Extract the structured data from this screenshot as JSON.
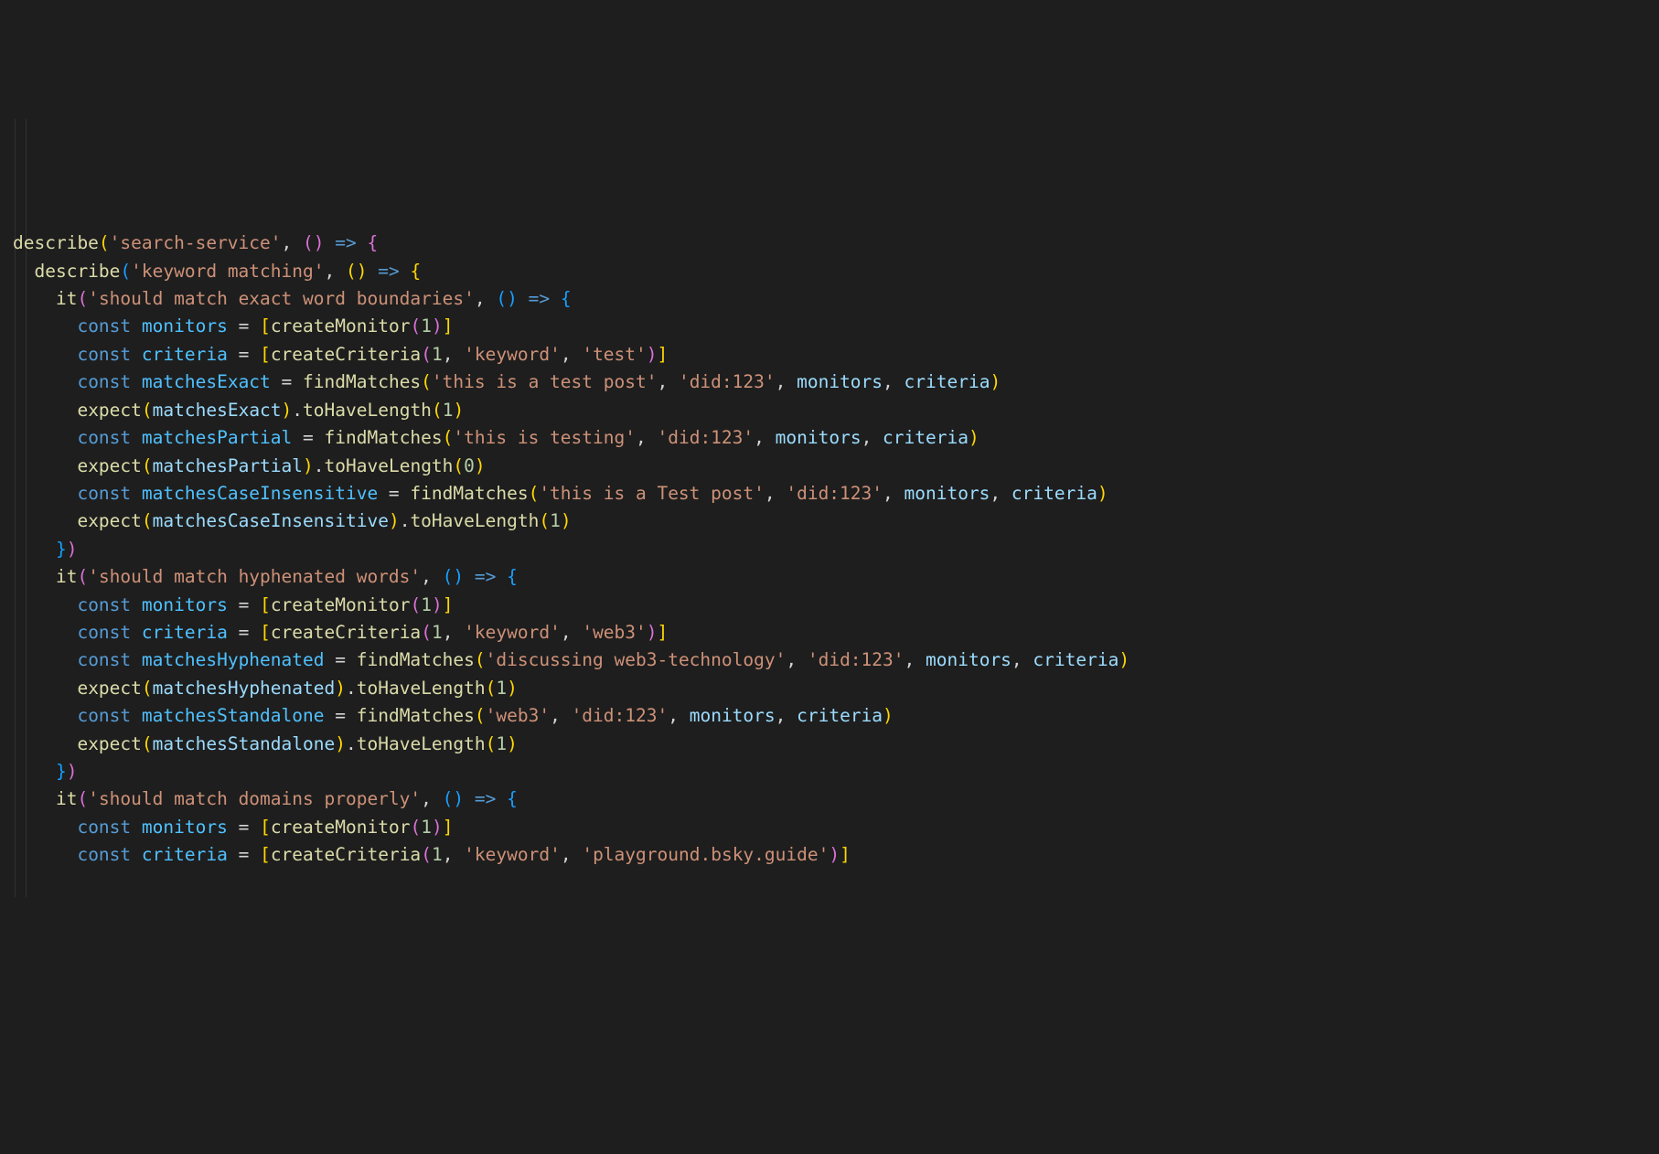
{
  "tokens": [
    [
      {
        "c": "fn",
        "t": "describe"
      },
      {
        "c": "paren1",
        "t": "("
      },
      {
        "c": "str",
        "t": "'search-service'"
      },
      {
        "c": "op",
        "t": ", "
      },
      {
        "c": "paren2",
        "t": "("
      },
      {
        "c": "paren2",
        "t": ")"
      },
      {
        "c": "op",
        "t": " "
      },
      {
        "c": "kw",
        "t": "=>"
      },
      {
        "c": "op",
        "t": " "
      },
      {
        "c": "paren2",
        "t": "{"
      }
    ],
    [
      {
        "c": "op",
        "t": "  "
      },
      {
        "c": "fn",
        "t": "describe"
      },
      {
        "c": "paren3",
        "t": "("
      },
      {
        "c": "str",
        "t": "'keyword matching'"
      },
      {
        "c": "op",
        "t": ", "
      },
      {
        "c": "paren1",
        "t": "("
      },
      {
        "c": "paren1",
        "t": ")"
      },
      {
        "c": "op",
        "t": " "
      },
      {
        "c": "kw",
        "t": "=>"
      },
      {
        "c": "op",
        "t": " "
      },
      {
        "c": "paren1",
        "t": "{"
      }
    ],
    [
      {
        "c": "op",
        "t": "    "
      },
      {
        "c": "fn",
        "t": "it"
      },
      {
        "c": "paren2",
        "t": "("
      },
      {
        "c": "str",
        "t": "'should match exact word boundaries'"
      },
      {
        "c": "op",
        "t": ", "
      },
      {
        "c": "paren3",
        "t": "("
      },
      {
        "c": "paren3",
        "t": ")"
      },
      {
        "c": "op",
        "t": " "
      },
      {
        "c": "kw",
        "t": "=>"
      },
      {
        "c": "op",
        "t": " "
      },
      {
        "c": "paren3",
        "t": "{"
      }
    ],
    [
      {
        "c": "op",
        "t": "      "
      },
      {
        "c": "kw",
        "t": "const"
      },
      {
        "c": "op",
        "t": " "
      },
      {
        "c": "const",
        "t": "monitors"
      },
      {
        "c": "op",
        "t": " = "
      },
      {
        "c": "paren1",
        "t": "["
      },
      {
        "c": "fn",
        "t": "createMonitor"
      },
      {
        "c": "paren2",
        "t": "("
      },
      {
        "c": "num",
        "t": "1"
      },
      {
        "c": "paren2",
        "t": ")"
      },
      {
        "c": "paren1",
        "t": "]"
      }
    ],
    [
      {
        "c": "op",
        "t": "      "
      },
      {
        "c": "kw",
        "t": "const"
      },
      {
        "c": "op",
        "t": " "
      },
      {
        "c": "const",
        "t": "criteria"
      },
      {
        "c": "op",
        "t": " = "
      },
      {
        "c": "paren1",
        "t": "["
      },
      {
        "c": "fn",
        "t": "createCriteria"
      },
      {
        "c": "paren2",
        "t": "("
      },
      {
        "c": "num",
        "t": "1"
      },
      {
        "c": "op",
        "t": ", "
      },
      {
        "c": "str",
        "t": "'keyword'"
      },
      {
        "c": "op",
        "t": ", "
      },
      {
        "c": "str",
        "t": "'test'"
      },
      {
        "c": "paren2",
        "t": ")"
      },
      {
        "c": "paren1",
        "t": "]"
      }
    ],
    [
      {
        "c": "op",
        "t": ""
      }
    ],
    [
      {
        "c": "op",
        "t": "      "
      },
      {
        "c": "kw",
        "t": "const"
      },
      {
        "c": "op",
        "t": " "
      },
      {
        "c": "const",
        "t": "matchesExact"
      },
      {
        "c": "op",
        "t": " = "
      },
      {
        "c": "fn",
        "t": "findMatches"
      },
      {
        "c": "paren1",
        "t": "("
      },
      {
        "c": "str",
        "t": "'this is a test post'"
      },
      {
        "c": "op",
        "t": ", "
      },
      {
        "c": "str",
        "t": "'did:123'"
      },
      {
        "c": "op",
        "t": ", "
      },
      {
        "c": "var",
        "t": "monitors"
      },
      {
        "c": "op",
        "t": ", "
      },
      {
        "c": "var",
        "t": "criteria"
      },
      {
        "c": "paren1",
        "t": ")"
      }
    ],
    [
      {
        "c": "op",
        "t": "      "
      },
      {
        "c": "fn",
        "t": "expect"
      },
      {
        "c": "paren1",
        "t": "("
      },
      {
        "c": "var",
        "t": "matchesExact"
      },
      {
        "c": "paren1",
        "t": ")"
      },
      {
        "c": "op",
        "t": "."
      },
      {
        "c": "fn",
        "t": "toHaveLength"
      },
      {
        "c": "paren1",
        "t": "("
      },
      {
        "c": "num",
        "t": "1"
      },
      {
        "c": "paren1",
        "t": ")"
      }
    ],
    [
      {
        "c": "op",
        "t": ""
      }
    ],
    [
      {
        "c": "op",
        "t": "      "
      },
      {
        "c": "kw",
        "t": "const"
      },
      {
        "c": "op",
        "t": " "
      },
      {
        "c": "const",
        "t": "matchesPartial"
      },
      {
        "c": "op",
        "t": " = "
      },
      {
        "c": "fn",
        "t": "findMatches"
      },
      {
        "c": "paren1",
        "t": "("
      },
      {
        "c": "str",
        "t": "'this is testing'"
      },
      {
        "c": "op",
        "t": ", "
      },
      {
        "c": "str",
        "t": "'did:123'"
      },
      {
        "c": "op",
        "t": ", "
      },
      {
        "c": "var",
        "t": "monitors"
      },
      {
        "c": "op",
        "t": ", "
      },
      {
        "c": "var",
        "t": "criteria"
      },
      {
        "c": "paren1",
        "t": ")"
      }
    ],
    [
      {
        "c": "op",
        "t": "      "
      },
      {
        "c": "fn",
        "t": "expect"
      },
      {
        "c": "paren1",
        "t": "("
      },
      {
        "c": "var",
        "t": "matchesPartial"
      },
      {
        "c": "paren1",
        "t": ")"
      },
      {
        "c": "op",
        "t": "."
      },
      {
        "c": "fn",
        "t": "toHaveLength"
      },
      {
        "c": "paren1",
        "t": "("
      },
      {
        "c": "num",
        "t": "0"
      },
      {
        "c": "paren1",
        "t": ")"
      }
    ],
    [
      {
        "c": "op",
        "t": ""
      }
    ],
    [
      {
        "c": "op",
        "t": "      "
      },
      {
        "c": "kw",
        "t": "const"
      },
      {
        "c": "op",
        "t": " "
      },
      {
        "c": "const",
        "t": "matchesCaseInsensitive"
      },
      {
        "c": "op",
        "t": " = "
      },
      {
        "c": "fn",
        "t": "findMatches"
      },
      {
        "c": "paren1",
        "t": "("
      },
      {
        "c": "str",
        "t": "'this is a Test post'"
      },
      {
        "c": "op",
        "t": ", "
      },
      {
        "c": "str",
        "t": "'did:123'"
      },
      {
        "c": "op",
        "t": ", "
      },
      {
        "c": "var",
        "t": "monitors"
      },
      {
        "c": "op",
        "t": ", "
      },
      {
        "c": "var",
        "t": "criteria"
      },
      {
        "c": "paren1",
        "t": ")"
      }
    ],
    [
      {
        "c": "op",
        "t": "      "
      },
      {
        "c": "fn",
        "t": "expect"
      },
      {
        "c": "paren1",
        "t": "("
      },
      {
        "c": "var",
        "t": "matchesCaseInsensitive"
      },
      {
        "c": "paren1",
        "t": ")"
      },
      {
        "c": "op",
        "t": "."
      },
      {
        "c": "fn",
        "t": "toHaveLength"
      },
      {
        "c": "paren1",
        "t": "("
      },
      {
        "c": "num",
        "t": "1"
      },
      {
        "c": "paren1",
        "t": ")"
      }
    ],
    [
      {
        "c": "op",
        "t": "    "
      },
      {
        "c": "paren3",
        "t": "}"
      },
      {
        "c": "paren2",
        "t": ")"
      }
    ],
    [
      {
        "c": "op",
        "t": ""
      }
    ],
    [
      {
        "c": "op",
        "t": "    "
      },
      {
        "c": "fn",
        "t": "it"
      },
      {
        "c": "paren2",
        "t": "("
      },
      {
        "c": "str",
        "t": "'should match hyphenated words'"
      },
      {
        "c": "op",
        "t": ", "
      },
      {
        "c": "paren3",
        "t": "("
      },
      {
        "c": "paren3",
        "t": ")"
      },
      {
        "c": "op",
        "t": " "
      },
      {
        "c": "kw",
        "t": "=>"
      },
      {
        "c": "op",
        "t": " "
      },
      {
        "c": "paren3",
        "t": "{"
      }
    ],
    [
      {
        "c": "op",
        "t": "      "
      },
      {
        "c": "kw",
        "t": "const"
      },
      {
        "c": "op",
        "t": " "
      },
      {
        "c": "const",
        "t": "monitors"
      },
      {
        "c": "op",
        "t": " = "
      },
      {
        "c": "paren1",
        "t": "["
      },
      {
        "c": "fn",
        "t": "createMonitor"
      },
      {
        "c": "paren2",
        "t": "("
      },
      {
        "c": "num",
        "t": "1"
      },
      {
        "c": "paren2",
        "t": ")"
      },
      {
        "c": "paren1",
        "t": "]"
      }
    ],
    [
      {
        "c": "op",
        "t": "      "
      },
      {
        "c": "kw",
        "t": "const"
      },
      {
        "c": "op",
        "t": " "
      },
      {
        "c": "const",
        "t": "criteria"
      },
      {
        "c": "op",
        "t": " = "
      },
      {
        "c": "paren1",
        "t": "["
      },
      {
        "c": "fn",
        "t": "createCriteria"
      },
      {
        "c": "paren2",
        "t": "("
      },
      {
        "c": "num",
        "t": "1"
      },
      {
        "c": "op",
        "t": ", "
      },
      {
        "c": "str",
        "t": "'keyword'"
      },
      {
        "c": "op",
        "t": ", "
      },
      {
        "c": "str",
        "t": "'web3'"
      },
      {
        "c": "paren2",
        "t": ")"
      },
      {
        "c": "paren1",
        "t": "]"
      }
    ],
    [
      {
        "c": "op",
        "t": ""
      }
    ],
    [
      {
        "c": "op",
        "t": "      "
      },
      {
        "c": "kw",
        "t": "const"
      },
      {
        "c": "op",
        "t": " "
      },
      {
        "c": "const",
        "t": "matchesHyphenated"
      },
      {
        "c": "op",
        "t": " = "
      },
      {
        "c": "fn",
        "t": "findMatches"
      },
      {
        "c": "paren1",
        "t": "("
      },
      {
        "c": "str",
        "t": "'discussing web3-technology'"
      },
      {
        "c": "op",
        "t": ", "
      },
      {
        "c": "str",
        "t": "'did:123'"
      },
      {
        "c": "op",
        "t": ", "
      },
      {
        "c": "var",
        "t": "monitors"
      },
      {
        "c": "op",
        "t": ", "
      },
      {
        "c": "var",
        "t": "criteria"
      },
      {
        "c": "paren1",
        "t": ")"
      }
    ],
    [
      {
        "c": "op",
        "t": "      "
      },
      {
        "c": "fn",
        "t": "expect"
      },
      {
        "c": "paren1",
        "t": "("
      },
      {
        "c": "var",
        "t": "matchesHyphenated"
      },
      {
        "c": "paren1",
        "t": ")"
      },
      {
        "c": "op",
        "t": "."
      },
      {
        "c": "fn",
        "t": "toHaveLength"
      },
      {
        "c": "paren1",
        "t": "("
      },
      {
        "c": "num",
        "t": "1"
      },
      {
        "c": "paren1",
        "t": ")"
      }
    ],
    [
      {
        "c": "op",
        "t": ""
      }
    ],
    [
      {
        "c": "op",
        "t": "      "
      },
      {
        "c": "kw",
        "t": "const"
      },
      {
        "c": "op",
        "t": " "
      },
      {
        "c": "const",
        "t": "matchesStandalone"
      },
      {
        "c": "op",
        "t": " = "
      },
      {
        "c": "fn",
        "t": "findMatches"
      },
      {
        "c": "paren1",
        "t": "("
      },
      {
        "c": "str",
        "t": "'web3'"
      },
      {
        "c": "op",
        "t": ", "
      },
      {
        "c": "str",
        "t": "'did:123'"
      },
      {
        "c": "op",
        "t": ", "
      },
      {
        "c": "var",
        "t": "monitors"
      },
      {
        "c": "op",
        "t": ", "
      },
      {
        "c": "var",
        "t": "criteria"
      },
      {
        "c": "paren1",
        "t": ")"
      }
    ],
    [
      {
        "c": "op",
        "t": "      "
      },
      {
        "c": "fn",
        "t": "expect"
      },
      {
        "c": "paren1",
        "t": "("
      },
      {
        "c": "var",
        "t": "matchesStandalone"
      },
      {
        "c": "paren1",
        "t": ")"
      },
      {
        "c": "op",
        "t": "."
      },
      {
        "c": "fn",
        "t": "toHaveLength"
      },
      {
        "c": "paren1",
        "t": "("
      },
      {
        "c": "num",
        "t": "1"
      },
      {
        "c": "paren1",
        "t": ")"
      }
    ],
    [
      {
        "c": "op",
        "t": "    "
      },
      {
        "c": "paren3",
        "t": "}"
      },
      {
        "c": "paren2",
        "t": ")"
      }
    ],
    [
      {
        "c": "op",
        "t": ""
      }
    ],
    [
      {
        "c": "op",
        "t": "    "
      },
      {
        "c": "fn",
        "t": "it"
      },
      {
        "c": "paren2",
        "t": "("
      },
      {
        "c": "str",
        "t": "'should match domains properly'"
      },
      {
        "c": "op",
        "t": ", "
      },
      {
        "c": "paren3",
        "t": "("
      },
      {
        "c": "paren3",
        "t": ")"
      },
      {
        "c": "op",
        "t": " "
      },
      {
        "c": "kw",
        "t": "=>"
      },
      {
        "c": "op",
        "t": " "
      },
      {
        "c": "paren3",
        "t": "{"
      }
    ],
    [
      {
        "c": "op",
        "t": "      "
      },
      {
        "c": "kw",
        "t": "const"
      },
      {
        "c": "op",
        "t": " "
      },
      {
        "c": "const",
        "t": "monitors"
      },
      {
        "c": "op",
        "t": " = "
      },
      {
        "c": "paren1",
        "t": "["
      },
      {
        "c": "fn",
        "t": "createMonitor"
      },
      {
        "c": "paren2",
        "t": "("
      },
      {
        "c": "num",
        "t": "1"
      },
      {
        "c": "paren2",
        "t": ")"
      },
      {
        "c": "paren1",
        "t": "]"
      }
    ],
    [
      {
        "c": "op",
        "t": "      "
      },
      {
        "c": "kw",
        "t": "const"
      },
      {
        "c": "op",
        "t": " "
      },
      {
        "c": "const",
        "t": "criteria"
      },
      {
        "c": "op",
        "t": " = "
      },
      {
        "c": "paren1",
        "t": "["
      },
      {
        "c": "fn",
        "t": "createCriteria"
      },
      {
        "c": "paren2",
        "t": "("
      },
      {
        "c": "num",
        "t": "1"
      },
      {
        "c": "op",
        "t": ", "
      },
      {
        "c": "str",
        "t": "'keyword'"
      },
      {
        "c": "op",
        "t": ", "
      },
      {
        "c": "str",
        "t": "'playground.bsky.guide'"
      },
      {
        "c": "paren2",
        "t": ")"
      },
      {
        "c": "paren1",
        "t": "]"
      }
    ]
  ]
}
